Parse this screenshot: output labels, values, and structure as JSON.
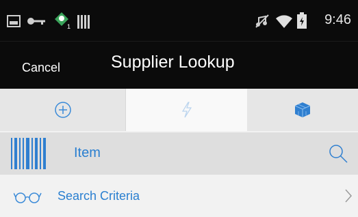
{
  "status_bar": {
    "time": "9:46",
    "icons": [
      "image-icon",
      "key-icon",
      "android-notification-icon",
      "signal-bars-icon",
      "mute-icon",
      "wifi-icon",
      "battery-icon"
    ]
  },
  "header": {
    "cancel_label": "Cancel",
    "title": "Supplier Lookup"
  },
  "tabs": [
    {
      "icon": "add-circle-icon",
      "selected": false
    },
    {
      "icon": "lightning-icon",
      "selected": true
    },
    {
      "icon": "cube-icon",
      "selected": false
    }
  ],
  "item_row": {
    "label": "Item",
    "icons": [
      "barcode-icon",
      "search-icon"
    ]
  },
  "criteria_row": {
    "label": "Search Criteria",
    "icons": [
      "glasses-icon",
      "chevron-right-icon"
    ]
  },
  "colors": {
    "header_bg": "#0b0b0b",
    "accent_blue": "#2a7fd0",
    "tab_bg": "#e6e6e6",
    "tab_selected_bg": "#f9f9f9",
    "row_bg": "#dedede"
  }
}
